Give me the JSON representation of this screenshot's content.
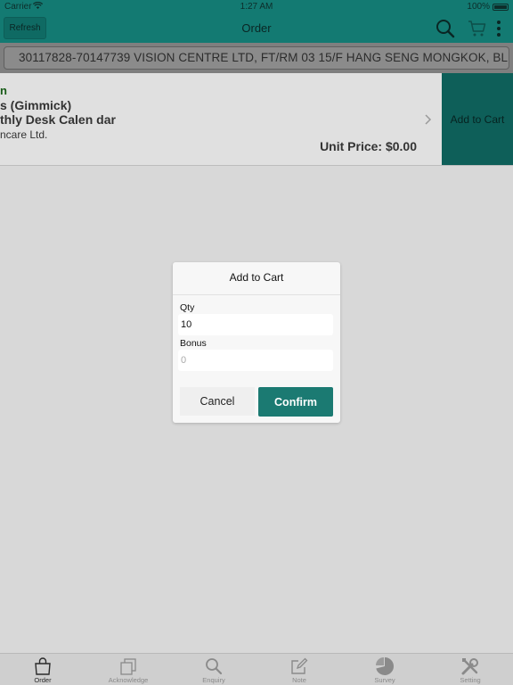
{
  "status_bar": {
    "carrier": "Carrier",
    "time": "1:27 AM",
    "battery": "100%"
  },
  "nav": {
    "refresh_label": "Refresh",
    "title": "Order"
  },
  "customer": {
    "text": "30117828-70147739 VISION CENTRE LTD, FT/RM 03 15/F HANG SENG MONGKOK, BL..."
  },
  "product": {
    "line1": "n",
    "line2": "s (Gimmick)",
    "line3": "thly Desk Calen dar",
    "line4": "ncare Ltd.",
    "unit_price": "Unit Price: $0.00",
    "add_to_cart_label": "Add to Cart"
  },
  "dialog": {
    "title": "Add to Cart",
    "qty_label": "Qty",
    "qty_value": "10",
    "bonus_label": "Bonus",
    "bonus_placeholder": "0",
    "cancel_label": "Cancel",
    "confirm_label": "Confirm"
  },
  "tabs": [
    {
      "label": "Order",
      "icon": "shopping-bag-icon",
      "active": true
    },
    {
      "label": "Acknowledge",
      "icon": "copy-icon",
      "active": false
    },
    {
      "label": "Enquiry",
      "icon": "search-icon",
      "active": false
    },
    {
      "label": "Note",
      "icon": "edit-icon",
      "active": false
    },
    {
      "label": "Survey",
      "icon": "pie-chart-icon",
      "active": false
    },
    {
      "label": "Setting",
      "icon": "tools-icon",
      "active": false
    }
  ],
  "colors": {
    "brand": "#137a72",
    "confirm": "#1b7a72"
  }
}
